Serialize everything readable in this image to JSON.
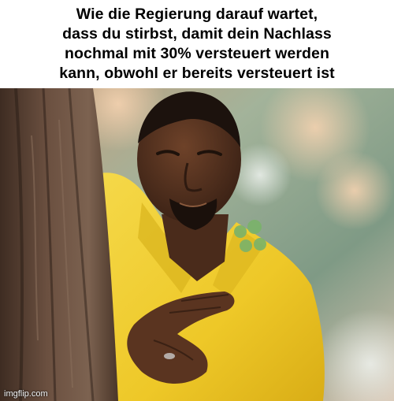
{
  "meme": {
    "caption": "Wie die Regierung darauf wartet,\ndass du stirbst, damit dein Nachlass\nnochmal mit 30% versteuert werden\nkann, obwohl er bereits versteuert ist",
    "watermark": "imgflip.com"
  },
  "photo": {
    "icons": [
      "tree-trunk-icon",
      "man-peeking-icon",
      "clover-icon"
    ],
    "colors": {
      "jacket": "#f2cf2c",
      "skin": "#5a3420",
      "bark": "#5b4233",
      "background_green": "#8ea68c",
      "background_warm": "#d2a683"
    }
  }
}
